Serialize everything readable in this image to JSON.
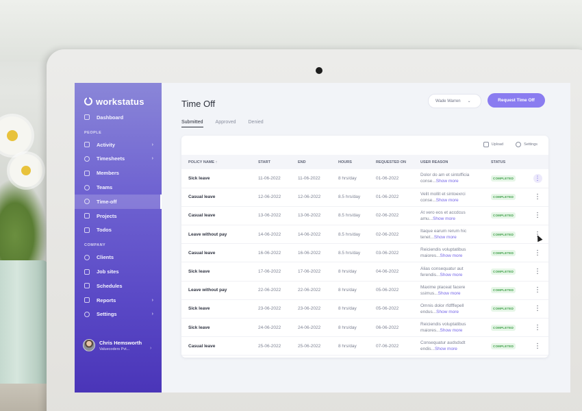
{
  "sidebar": {
    "logo_text": "workstatus",
    "dashboard": "Dashboard",
    "section_people": "PEOPLE",
    "people_items": [
      "Activity",
      "Timesheets",
      "Members",
      "Teams",
      "Time-off",
      "Projects",
      "Todos"
    ],
    "section_company": "COMPANY",
    "company_items": [
      "Clients",
      "Job sites",
      "Schedules",
      "Reports",
      "Settings"
    ],
    "user_name": "Chris Hemsworth",
    "user_org": "Valuecoders Pvt..."
  },
  "header": {
    "title": "Time Off",
    "user_select": "Wade Warren",
    "request_button": "Request Time Off"
  },
  "tabs": [
    "Submitted",
    "Approved",
    "Denied"
  ],
  "toolbar": {
    "upload": "Upload",
    "settings": "Settings"
  },
  "table": {
    "columns": [
      "POLICY NAME ↑",
      "START",
      "END",
      "HOURS",
      "REQUESTED ON",
      "USER REASON",
      "STATUS"
    ],
    "show_more": "Show more",
    "rows": [
      {
        "policy": "Sick leave",
        "start": "11-06-2022",
        "end": "11-06-2022",
        "hours": "8 hrs/day",
        "requested": "01-06-2022",
        "reason1": "Dolor do am et sintofficia",
        "reason2": "conse...",
        "status": "COMPLETED"
      },
      {
        "policy": "Casual leave",
        "start": "12-06-2022",
        "end": "12-06-2022",
        "hours": "8.5 hrs/day",
        "requested": "01-06-2022",
        "reason1": "Velit mollit et sintoexrci",
        "reason2": "conse...",
        "status": "COMPLETED"
      },
      {
        "policy": "Casual leave",
        "start": "13-06-2022",
        "end": "13-06-2022",
        "hours": "8.5 hrs/day",
        "requested": "02-06-2022",
        "reason1": "At vero eos et accdcus",
        "reason2": "amu...",
        "status": "COMPLETED"
      },
      {
        "policy": "Leave without pay",
        "start": "14-06-2022",
        "end": "14-06-2022",
        "hours": "8.5 hrs/day",
        "requested": "02-06-2022",
        "reason1": "Itaque earum rerum hic",
        "reason2": "tenet...",
        "status": "COMPLETED"
      },
      {
        "policy": "Casual leave",
        "start": "16-06-2022",
        "end": "16-06-2022",
        "hours": "8.5 hrs/day",
        "requested": "03-06-2022",
        "reason1": "Reiciendis voluptatibus",
        "reason2": "maiores...",
        "status": "COMPLETED"
      },
      {
        "policy": "Sick leave",
        "start": "17-06-2022",
        "end": "17-06-2022",
        "hours": "8 hrs/day",
        "requested": "04-06-2022",
        "reason1": "Alias consequatur aut",
        "reason2": "ferendis...",
        "status": "COMPLETED"
      },
      {
        "policy": "Leave without pay",
        "start": "22-06-2022",
        "end": "22-06-2022",
        "hours": "8 hrs/day",
        "requested": "05-06-2022",
        "reason1": "Maxime placeat facere",
        "reason2": "ssimus...",
        "status": "COMPLETED"
      },
      {
        "policy": "Sick leave",
        "start": "23-06-2022",
        "end": "23-06-2022",
        "hours": "8 hrs/day",
        "requested": "05-06-2022",
        "reason1": "Omnis dolor rfdfffepell",
        "reason2": "endus...",
        "status": "COMPLETED"
      },
      {
        "policy": "Sick leave",
        "start": "24-06-2022",
        "end": "24-06-2022",
        "hours": "8 hrs/day",
        "requested": "06-06-2022",
        "reason1": "Reiciendis voluptatibus",
        "reason2": "maiores...",
        "status": "COMPLETED"
      },
      {
        "policy": "Casual leave",
        "start": "25-06-2022",
        "end": "25-06-2022",
        "hours": "8 hrs/day",
        "requested": "07-06-2022",
        "reason1": "Consequatur audsdsdt",
        "reason2": "endis...",
        "status": "COMPLETED"
      }
    ]
  },
  "colors": {
    "accent": "#8a7cf0",
    "sidebar_top": "#8a86d8",
    "sidebar_bottom": "#4a35b8",
    "status_green": "#3e9f48"
  }
}
